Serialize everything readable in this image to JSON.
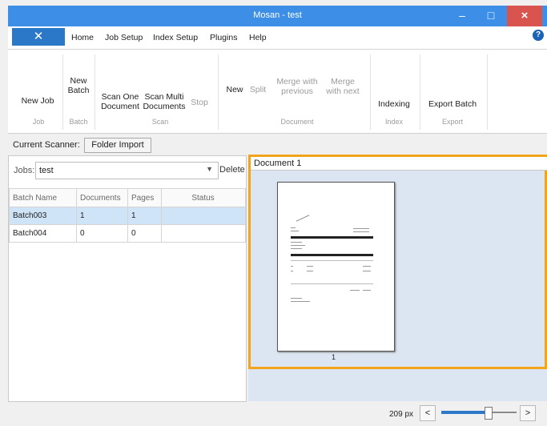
{
  "window": {
    "title": "Mosan - test",
    "minimize": "–",
    "maximize": "□",
    "close": "×"
  },
  "menu": {
    "app_icon": "✕",
    "items": [
      "Home",
      "Job Setup",
      "Index Setup",
      "Plugins",
      "Help"
    ],
    "help_icon": "?"
  },
  "ribbon": {
    "buttons": {
      "new_job": "New Job",
      "new_batch": "New Batch",
      "scan_one": "Scan One Document",
      "scan_multi": "Scan Multi Documents",
      "stop": "Stop",
      "new_doc": "New",
      "split": "Split",
      "merge_prev": "Merge with previous",
      "merge_next": "Merge with next",
      "indexing": "Indexing",
      "export_batch": "Export Batch"
    },
    "groups": {
      "job": "Job",
      "batch": "Batch",
      "scan": "Scan",
      "document": "Document",
      "index": "Index",
      "export": "Export"
    }
  },
  "scanner": {
    "label": "Current Scanner:",
    "value": "Folder Import"
  },
  "jobs": {
    "label": "Jobs:",
    "selected": "test",
    "delete_label": "Delete"
  },
  "table": {
    "columns": [
      "Batch Name",
      "Documents",
      "Pages",
      "Status"
    ],
    "rows": [
      [
        "Batch003",
        "1",
        "1",
        ""
      ],
      [
        "Batch004",
        "0",
        "0",
        ""
      ]
    ]
  },
  "document": {
    "title": "Document 1",
    "page_number": "1"
  },
  "zoom": {
    "label": "209 px",
    "prev": "<",
    "next": ">",
    "level_fraction": 0.62
  },
  "colors": {
    "titlebar": "#3c8ee6",
    "accent": "#2b78c8",
    "selection_border": "#f2a51c",
    "selected_row": "#cfe4f7"
  }
}
